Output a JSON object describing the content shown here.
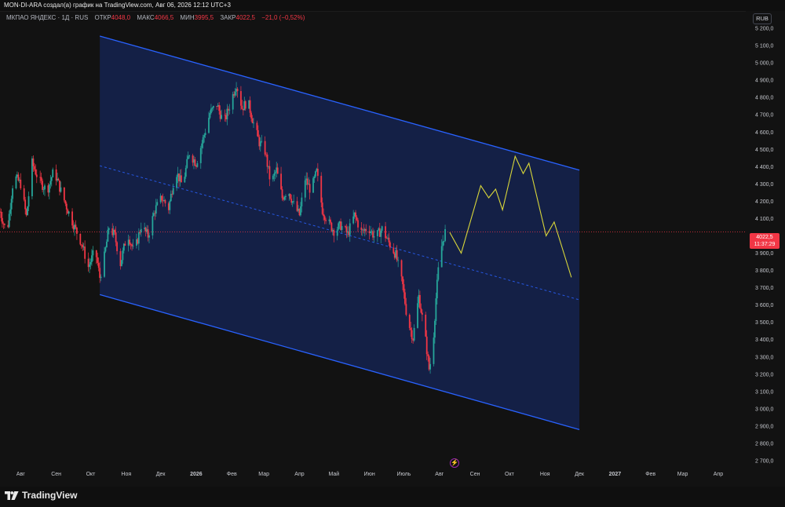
{
  "header": {
    "caption": "MON-DI-ARA создал(а) график на TradingView.com, Авг 06, 2026 12:12 UTC+3"
  },
  "legend": {
    "symbol": "МКПАО ЯНДЕКС · 1Д · RUS",
    "open_label": "ОТКР",
    "open_value": "4048,0",
    "high_label": "МАКС",
    "high_value": "4066,5",
    "low_label": "МИН",
    "low_value": "3995,5",
    "close_label": "ЗАКР",
    "close_value": "4022,5",
    "change": "−21,0 (−0,52%)"
  },
  "currency_button": "RUB",
  "price_tag": {
    "price": "4022,5",
    "countdown": "11:37:29"
  },
  "brand": "TradingView",
  "colors": {
    "up": "#26a69a",
    "down": "#f23645",
    "channel": "#2962ff",
    "channel_fill": "#15224a",
    "projection": "#d8d63a",
    "last_price_line": "#f23645"
  },
  "icons": [
    "tradingview-logo-icon",
    "lightning-bolt-icon"
  ],
  "chart_data": {
    "type": "candlestick",
    "y_axis": {
      "min": 2650,
      "max": 5300,
      "grid": false,
      "ticks": [
        5200,
        5100,
        5000,
        4900,
        4800,
        4700,
        4600,
        4500,
        4400,
        4300,
        4200,
        4100,
        4000,
        3900,
        3800,
        3700,
        3600,
        3500,
        3400,
        3300,
        3200,
        3100,
        3000,
        2900,
        2800,
        2700
      ],
      "tick_labels": [
        "5 200,0",
        "5 100,0",
        "5 000,0",
        "4 900,0",
        "4 800,0",
        "4 700,0",
        "4 600,0",
        "4 500,0",
        "4 400,0",
        "4 300,0",
        "4 200,0",
        "4 100,0",
        "4 000,0",
        "3 900,0",
        "3 800,0",
        "3 700,0",
        "3 600,0",
        "3 500,0",
        "3 400,0",
        "3 300,0",
        "3 200,0",
        "3 100,0",
        "3 000,0",
        "2 900,0",
        "2 800,0",
        "2 700,0"
      ]
    },
    "x_axis": {
      "start": "2025-07-14",
      "end": "2027-04-25",
      "ticks": [
        {
          "date": "2025-08-01",
          "label": "Авг"
        },
        {
          "date": "2025-09-01",
          "label": "Сен"
        },
        {
          "date": "2025-10-01",
          "label": "Окт"
        },
        {
          "date": "2025-11-01",
          "label": "Ноя"
        },
        {
          "date": "2025-12-01",
          "label": "Дек"
        },
        {
          "date": "2026-01-01",
          "label": "2026"
        },
        {
          "date": "2026-02-01",
          "label": "Фев"
        },
        {
          "date": "2026-03-01",
          "label": "Мар"
        },
        {
          "date": "2026-04-01",
          "label": "Апр"
        },
        {
          "date": "2026-05-01",
          "label": "Май"
        },
        {
          "date": "2026-06-01",
          "label": "Июн"
        },
        {
          "date": "2026-07-01",
          "label": "Июль"
        },
        {
          "date": "2026-08-01",
          "label": "Авг"
        },
        {
          "date": "2026-09-01",
          "label": "Сен"
        },
        {
          "date": "2026-10-01",
          "label": "Окт"
        },
        {
          "date": "2026-11-01",
          "label": "Ноя"
        },
        {
          "date": "2026-12-01",
          "label": "Дек"
        },
        {
          "date": "2027-01-01",
          "label": "2027"
        },
        {
          "date": "2027-02-01",
          "label": "Фев"
        },
        {
          "date": "2027-03-01",
          "label": "Мар"
        },
        {
          "date": "2027-04-01",
          "label": "Апр"
        }
      ]
    },
    "price_path": [
      [
        "2025-07-14",
        4140
      ],
      [
        "2025-07-20",
        4010
      ],
      [
        "2025-07-26",
        4350
      ],
      [
        "2025-08-01",
        4300
      ],
      [
        "2025-08-06",
        4110
      ],
      [
        "2025-08-11",
        4420
      ],
      [
        "2025-08-17",
        4320
      ],
      [
        "2025-08-24",
        4260
      ],
      [
        "2025-08-30",
        4380
      ],
      [
        "2025-09-05",
        4260
      ],
      [
        "2025-09-11",
        4150
      ],
      [
        "2025-09-17",
        4050
      ],
      [
        "2025-09-23",
        3960
      ],
      [
        "2025-09-29",
        3820
      ],
      [
        "2025-10-05",
        3920
      ],
      [
        "2025-10-09",
        3760
      ],
      [
        "2025-10-13",
        3880
      ],
      [
        "2025-10-17",
        4050
      ],
      [
        "2025-10-22",
        4000
      ],
      [
        "2025-10-27",
        3840
      ],
      [
        "2025-11-02",
        4020
      ],
      [
        "2025-11-08",
        3900
      ],
      [
        "2025-11-14",
        4060
      ],
      [
        "2025-11-20",
        4000
      ],
      [
        "2025-11-26",
        4150
      ],
      [
        "2025-12-02",
        4220
      ],
      [
        "2025-12-08",
        4160
      ],
      [
        "2025-12-14",
        4380
      ],
      [
        "2025-12-20",
        4290
      ],
      [
        "2025-12-26",
        4480
      ],
      [
        "2026-01-01",
        4420
      ],
      [
        "2026-01-07",
        4560
      ],
      [
        "2026-01-13",
        4710
      ],
      [
        "2026-01-19",
        4760
      ],
      [
        "2026-01-25",
        4650
      ],
      [
        "2026-01-31",
        4770
      ],
      [
        "2026-02-05",
        4880
      ],
      [
        "2026-02-10",
        4740
      ],
      [
        "2026-02-15",
        4780
      ],
      [
        "2026-02-20",
        4650
      ],
      [
        "2026-02-25",
        4540
      ],
      [
        "2026-03-02",
        4490
      ],
      [
        "2026-03-07",
        4300
      ],
      [
        "2026-03-12",
        4380
      ],
      [
        "2026-03-17",
        4220
      ],
      [
        "2026-03-22",
        4270
      ],
      [
        "2026-03-27",
        4180
      ],
      [
        "2026-04-01",
        4120
      ],
      [
        "2026-04-06",
        4330
      ],
      [
        "2026-04-11",
        4260
      ],
      [
        "2026-04-16",
        4370
      ],
      [
        "2026-04-21",
        4150
      ],
      [
        "2026-04-26",
        4080
      ],
      [
        "2026-05-01",
        4030
      ],
      [
        "2026-05-07",
        4060
      ],
      [
        "2026-05-13",
        4010
      ],
      [
        "2026-05-19",
        4120
      ],
      [
        "2026-05-25",
        4020
      ],
      [
        "2026-05-31",
        4050
      ],
      [
        "2026-06-06",
        3990
      ],
      [
        "2026-06-12",
        4040
      ],
      [
        "2026-06-18",
        3960
      ],
      [
        "2026-06-24",
        3890
      ],
      [
        "2026-06-30",
        3710
      ],
      [
        "2026-07-04",
        3520
      ],
      [
        "2026-07-09",
        3410
      ],
      [
        "2026-07-14",
        3650
      ],
      [
        "2026-07-19",
        3450
      ],
      [
        "2026-07-23",
        3230
      ],
      [
        "2026-07-26",
        3330
      ],
      [
        "2026-07-29",
        3640
      ],
      [
        "2026-08-01",
        3880
      ],
      [
        "2026-08-04",
        3970
      ],
      [
        "2026-08-06",
        4022.5
      ]
    ],
    "channel": {
      "upper": [
        [
          "2025-10-09",
          5155
        ],
        [
          "2026-12-01",
          4380
        ]
      ],
      "lower": [
        [
          "2025-10-09",
          3660
        ],
        [
          "2026-12-01",
          2880
        ]
      ],
      "median": [
        [
          "2025-10-09",
          4405
        ],
        [
          "2026-12-01",
          3630
        ]
      ]
    },
    "projection": [
      [
        "2026-08-10",
        4020
      ],
      [
        "2026-08-20",
        3900
      ],
      [
        "2026-09-06",
        4290
      ],
      [
        "2026-09-13",
        4220
      ],
      [
        "2026-09-19",
        4270
      ],
      [
        "2026-09-25",
        4150
      ],
      [
        "2026-10-06",
        4460
      ],
      [
        "2026-10-13",
        4360
      ],
      [
        "2026-10-18",
        4420
      ],
      [
        "2026-11-02",
        4000
      ],
      [
        "2026-11-09",
        4080
      ],
      [
        "2026-11-24",
        3760
      ]
    ],
    "last_price": 4022.5
  }
}
